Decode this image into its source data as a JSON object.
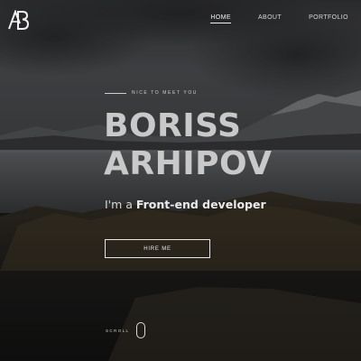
{
  "brand": {
    "logo_text": "AB"
  },
  "nav": {
    "items": [
      {
        "label": "HOME",
        "active": true
      },
      {
        "label": "ABOUT",
        "active": false
      },
      {
        "label": "PORTFOLIO",
        "active": false
      }
    ]
  },
  "hero": {
    "eyebrow": "NICE TO MEET YOU",
    "first_name": "BORISS",
    "last_name": "ARHIPOV",
    "tagline_prefix": "I'm a ",
    "tagline_role": "Front-end developer",
    "cta_label": "HIRE ME",
    "scroll_label": "SCROLL"
  },
  "colors": {
    "text_light": "#c9c9c9",
    "overlay": "#2a2b2d"
  }
}
